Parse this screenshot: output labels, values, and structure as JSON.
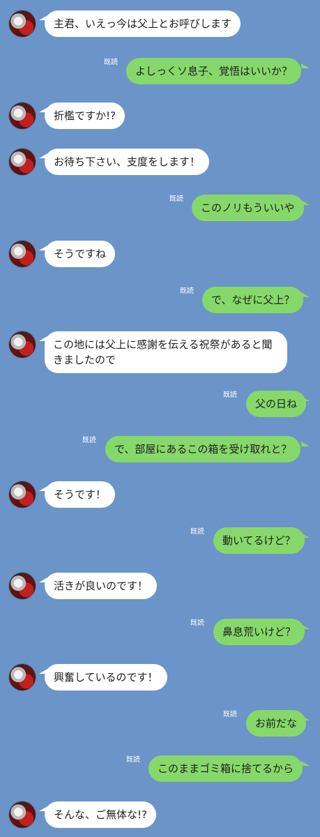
{
  "colors": {
    "background": "#6b94c8",
    "bubble_left": "#ffffff",
    "bubble_right": "#86d86a"
  },
  "messages": [
    {
      "side": "left",
      "text": "主君、いえっ今は父上とお呼びします"
    },
    {
      "side": "right",
      "text": "よしっくソ息子、覚悟はいいか？",
      "read": "既読"
    },
    {
      "side": "left",
      "text": "折檻ですか!?"
    },
    {
      "side": "left",
      "text": "お待ち下さい、支度をします！"
    },
    {
      "side": "right",
      "text": "このノリもういいや",
      "read": "既読"
    },
    {
      "side": "left",
      "text": "そうですね"
    },
    {
      "side": "right",
      "text": "で、なぜに父上？",
      "read": "既読"
    },
    {
      "side": "left",
      "text": "この地には父上に感謝を伝える祝祭があると聞きましたので"
    },
    {
      "side": "right",
      "text": "父の日ね",
      "read": "既読"
    },
    {
      "side": "right",
      "text": "で、部屋にあるこの箱を受け取れと？",
      "read": "既読"
    },
    {
      "side": "left",
      "text": "そうです！"
    },
    {
      "side": "right",
      "text": "動いてるけど？",
      "read": "既読"
    },
    {
      "side": "left",
      "text": "活きが良いのです！"
    },
    {
      "side": "right",
      "text": "鼻息荒いけど？",
      "read": "既読"
    },
    {
      "side": "left",
      "text": "興奮しているのです！"
    },
    {
      "side": "right",
      "text": "お前だな",
      "read": "既読"
    },
    {
      "side": "right",
      "text": "このままゴミ箱に捨てるから",
      "read": "既読"
    },
    {
      "side": "left",
      "text": "そんな、ご無体な!?"
    }
  ]
}
